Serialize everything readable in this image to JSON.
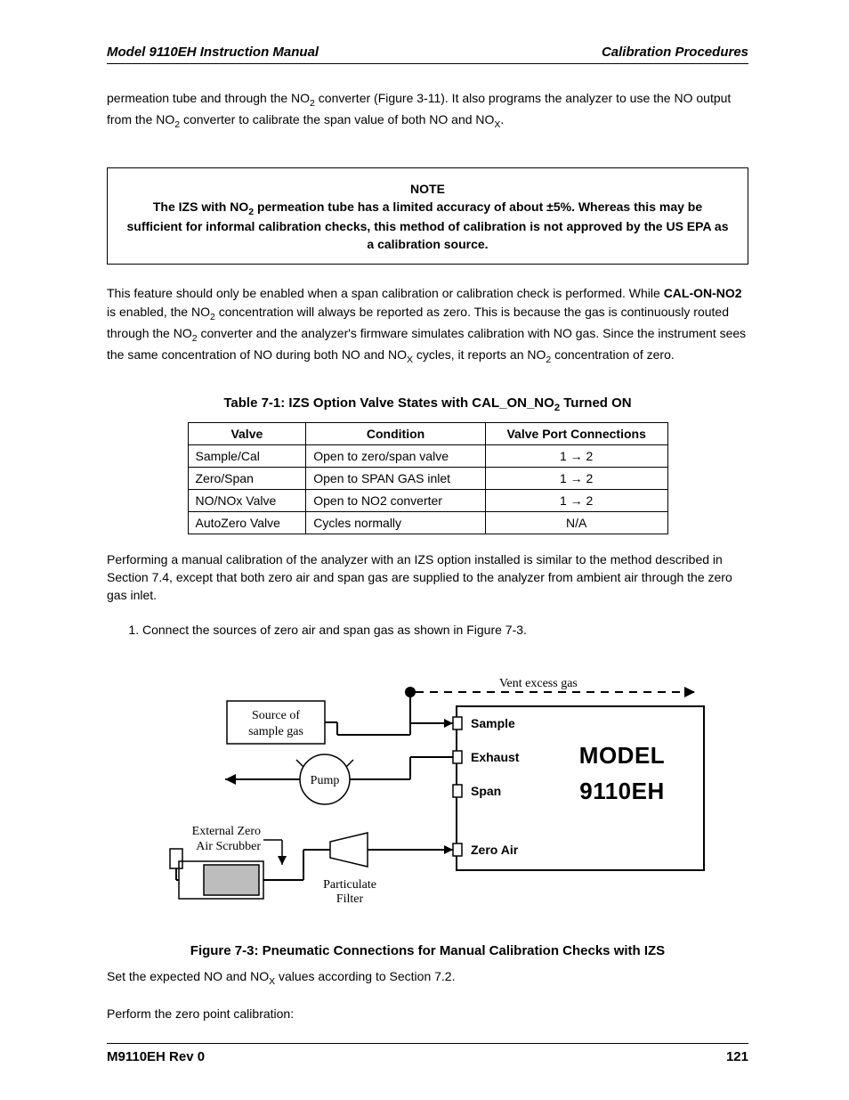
{
  "header": {
    "left": "Model 9110EH Instruction Manual",
    "right": "Calibration Procedures"
  },
  "intro": {
    "text1": "permeation tube and through the NO",
    "sub1": "2",
    "text2": " converter (Figure 3-11). It also programs the analyzer to use the NO output from the NO",
    "sub2": "2",
    "text3": " converter to calibrate the span value of both NO and NO",
    "sub3": "X",
    "text4": "."
  },
  "note": {
    "title": "NOTE",
    "l1a": "The IZS with NO",
    "l1sub": "2",
    "l1b": " permeation tube has a limited accuracy of about ±5%. Whereas this may be sufficient for informal calibration checks, this method of calibration is not approved by the US EPA as a calibration source."
  },
  "feature": {
    "t1": "This feature should only be enabled when a span calibration or calibration check is performed. While ",
    "bold1": "CAL-ON-NO2",
    "t2": " is enabled, the NO",
    "sub1": "2",
    "t3": " concentration will always be reported as zero. This is because the gas is continuously routed through the NO",
    "sub2": "2",
    "t4": " converter and the analyzer's firmware simulates calibration with NO gas. Since the instrument sees the same concentration of NO during both NO and NO",
    "sub3": "X",
    "t5": " cycles, it reports an NO",
    "sub4": "2",
    "t6": " concentration of zero."
  },
  "table_caption": {
    "a": "Table 7-1:    IZS Option Valve States with CAL_ON_NO",
    "sub": "2",
    "b": " Turned ON"
  },
  "table": {
    "headers": [
      "Valve",
      "Condition",
      "Valve Port Connections"
    ],
    "rows": [
      [
        "Sample/Cal",
        "Open to zero/span valve",
        "1 → 2"
      ],
      [
        "Zero/Span",
        "Open to SPAN GAS inlet",
        "1 → 2"
      ],
      [
        "NO/NOx Valve",
        "Open to NO2 converter",
        "1 → 2"
      ],
      [
        "AutoZero Valve",
        "Cycles normally",
        "N/A"
      ]
    ]
  },
  "perform": "Performing a manual calibration of the analyzer with an IZS option installed is similar to the method described in Section 7.4, except that both zero air and span gas are supplied to the analyzer from ambient air through the zero gas inlet.",
  "step1": "Connect the sources of zero air and span gas as shown in Figure 7-3.",
  "figure": {
    "vent": "Vent excess gas",
    "source1": "Source of",
    "source2": "sample gas",
    "pump": "Pump",
    "scrub1": "External Zero",
    "scrub2": "Air Scrubber",
    "partfilt1": "Particulate",
    "partfilt2": "Filter",
    "sample": "Sample",
    "exhaust": "Exhaust",
    "span": "Span",
    "zeroair": "Zero Air",
    "model1": "MODEL",
    "model2": "9110EH",
    "caption": "Figure 7-3:   Pneumatic Connections for Manual Calibration Checks with IZS"
  },
  "setexpected": {
    "a": "Set the expected NO and NO",
    "sub": "X",
    "b": " values according to Section 7.2."
  },
  "performzero": "Perform the zero point calibration:",
  "footer": {
    "left": "M9110EH Rev 0",
    "right": "121"
  }
}
